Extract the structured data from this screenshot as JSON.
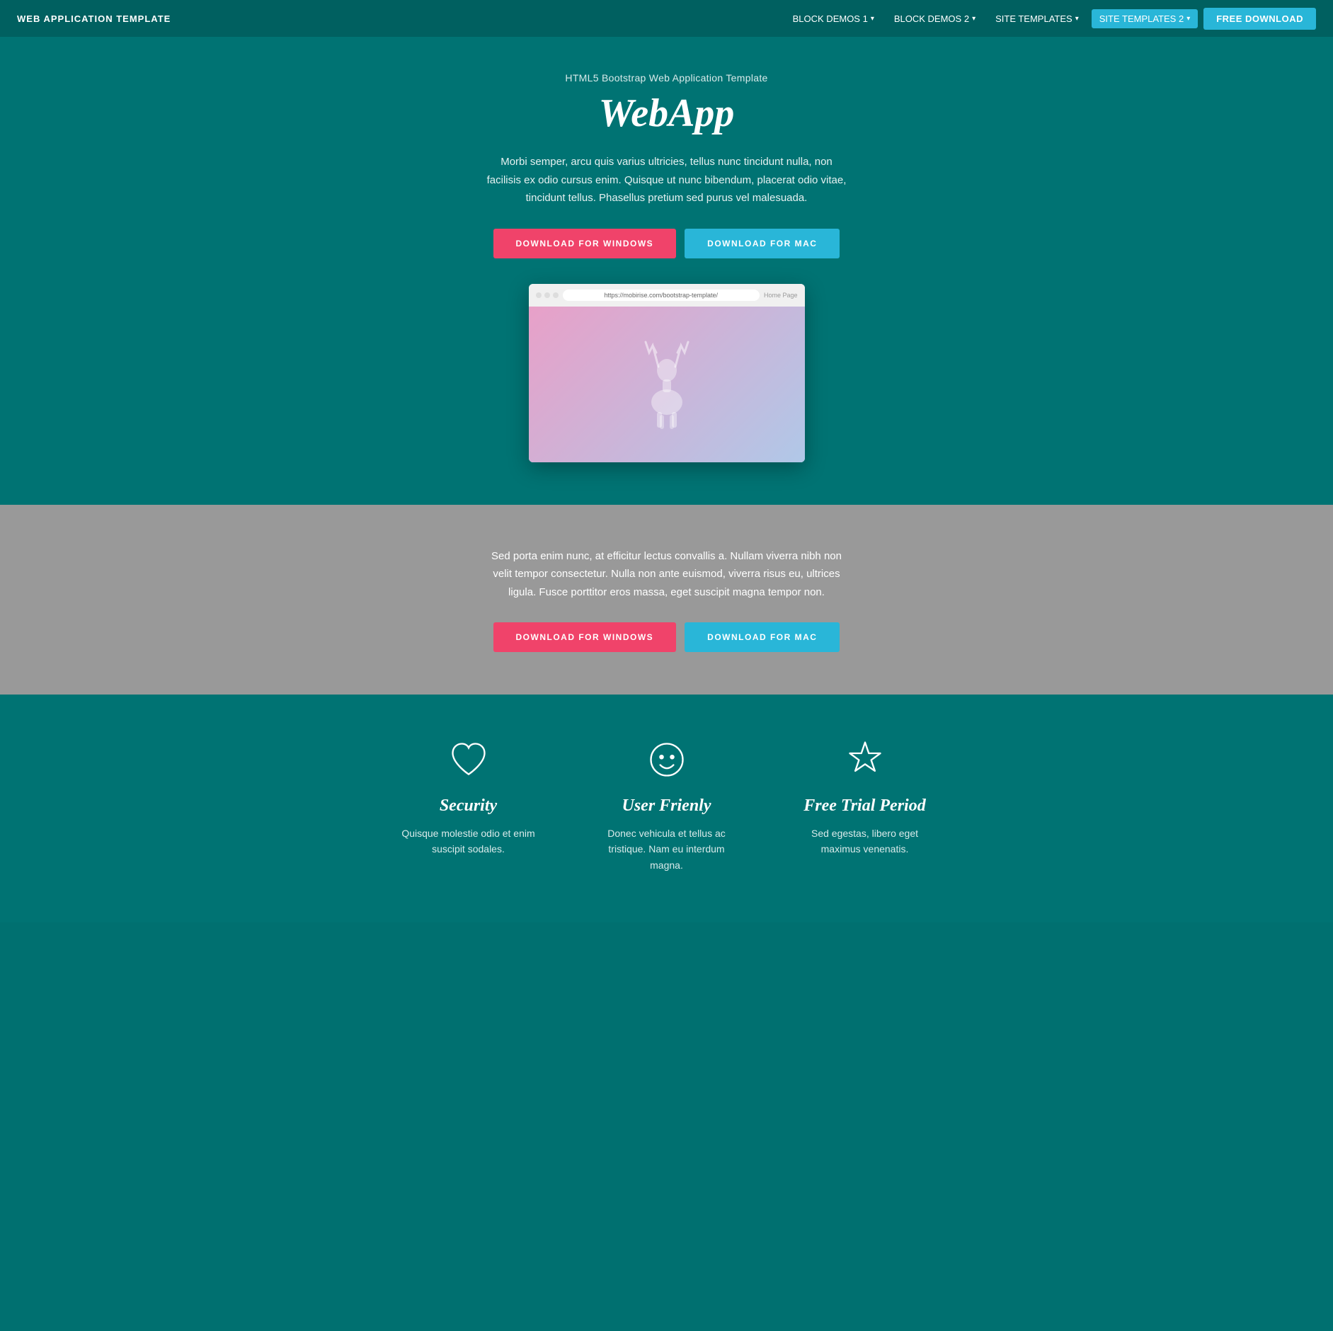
{
  "navbar": {
    "brand": "WEB APPLICATION TEMPLATE",
    "nav_items": [
      {
        "label": "BLOCK DEMOS 1",
        "active": false
      },
      {
        "label": "BLOCK DEMOS 2",
        "active": false
      },
      {
        "label": "SITE TEMPLATES",
        "active": false
      },
      {
        "label": "SITE TEMPLATES 2",
        "active": true
      }
    ],
    "cta_label": "FREE DOWNLOAD"
  },
  "hero": {
    "subtitle": "HTML5 Bootstrap Web Application Template",
    "title": "WebApp",
    "description": "Morbi semper, arcu quis varius ultricies, tellus nunc tincidunt nulla, non facilisis ex odio cursus enim. Quisque ut nunc bibendum, placerat odio vitae, tincidunt tellus. Phasellus pretium sed purus vel malesuada.",
    "btn_windows": "DOWNLOAD FOR WINDOWS",
    "btn_mac": "DOWNLOAD FOR MAC",
    "browser_url": "https://mobirise.com/bootstrap-template/",
    "browser_home": "Home Page"
  },
  "gray_section": {
    "description": "Sed porta enim nunc, at efficitur lectus convallis a. Nullam viverra nibh non velit tempor consectetur. Nulla non ante euismod, viverra risus eu, ultrices ligula. Fusce porttitor eros massa, eget suscipit magna tempor non.",
    "btn_windows": "DOWNLOAD FOR WINDOWS",
    "btn_mac": "DOWNLOAD FOR MAC"
  },
  "features": {
    "items": [
      {
        "icon": "heart",
        "title": "Security",
        "description": "Quisque molestie odio et enim suscipit sodales."
      },
      {
        "icon": "smiley",
        "title": "User Frienly",
        "description": "Donec vehicula et tellus ac tristique. Nam eu interdum magna."
      },
      {
        "icon": "star",
        "title": "Free Trial Period",
        "description": "Sed egestas, libero eget maximus venenatis."
      }
    ]
  }
}
